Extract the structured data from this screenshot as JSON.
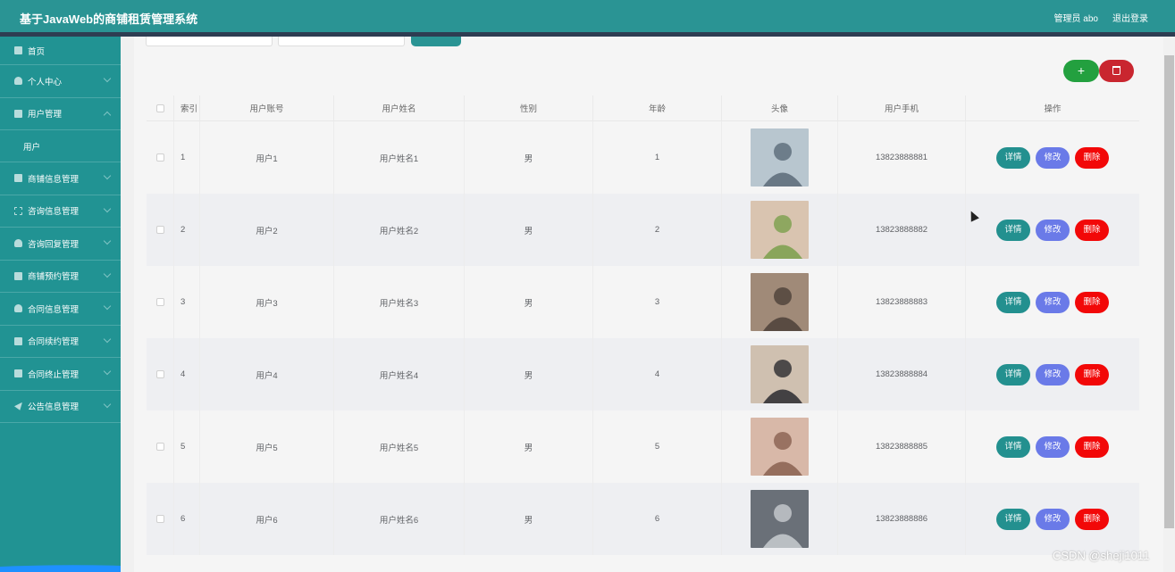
{
  "header": {
    "title": "基于JavaWeb的商铺租赁管理系统",
    "user": "管理员 abo",
    "logout": "退出登录"
  },
  "sidebar": {
    "items": [
      {
        "label": "首页",
        "icon": "home-icon"
      },
      {
        "label": "个人中心",
        "icon": "person-icon"
      },
      {
        "label": "用户管理",
        "icon": "user-icon",
        "expanded": true
      },
      {
        "label": "商铺信息管理",
        "icon": "shop-icon"
      },
      {
        "label": "咨询信息管理",
        "icon": "dashed-box-icon"
      },
      {
        "label": "咨询回复管理",
        "icon": "person-icon"
      },
      {
        "label": "商铺预约管理",
        "icon": "chart-icon"
      },
      {
        "label": "合同信息管理",
        "icon": "person-icon"
      },
      {
        "label": "合同续约管理",
        "icon": "building-icon"
      },
      {
        "label": "合同终止管理",
        "icon": "desk-icon"
      },
      {
        "label": "公告信息管理",
        "icon": "paper-plane-icon"
      }
    ],
    "submenu": {
      "label": "用户"
    }
  },
  "toolbar": {
    "add_label": "+",
    "delete_icon": "trash-icon"
  },
  "table": {
    "headers": [
      "索引",
      "用户账号",
      "用户姓名",
      "性别",
      "年龄",
      "头像",
      "用户手机",
      "操作"
    ],
    "rows": [
      {
        "index": "1",
        "account": "用户1",
        "name": "用户姓名1",
        "gender": "男",
        "age": "1",
        "phone": "13823888881"
      },
      {
        "index": "2",
        "account": "用户2",
        "name": "用户姓名2",
        "gender": "男",
        "age": "2",
        "phone": "13823888882"
      },
      {
        "index": "3",
        "account": "用户3",
        "name": "用户姓名3",
        "gender": "男",
        "age": "3",
        "phone": "13823888883"
      },
      {
        "index": "4",
        "account": "用户4",
        "name": "用户姓名4",
        "gender": "男",
        "age": "4",
        "phone": "13823888884"
      },
      {
        "index": "5",
        "account": "用户5",
        "name": "用户姓名5",
        "gender": "男",
        "age": "5",
        "phone": "13823888885"
      },
      {
        "index": "6",
        "account": "用户6",
        "name": "用户姓名6",
        "gender": "男",
        "age": "6",
        "phone": "13823888886"
      }
    ],
    "actions": {
      "detail": "详情",
      "edit": "修改",
      "delete": "删除"
    }
  },
  "watermark": "CSDN @sheji1011",
  "colors": {
    "header": "#2a9494",
    "sidebar": "#219393",
    "detail_button": "#23908f",
    "edit_button": "#6a7ae8",
    "delete_button": "#f20808",
    "add_button": "#23a03f"
  }
}
